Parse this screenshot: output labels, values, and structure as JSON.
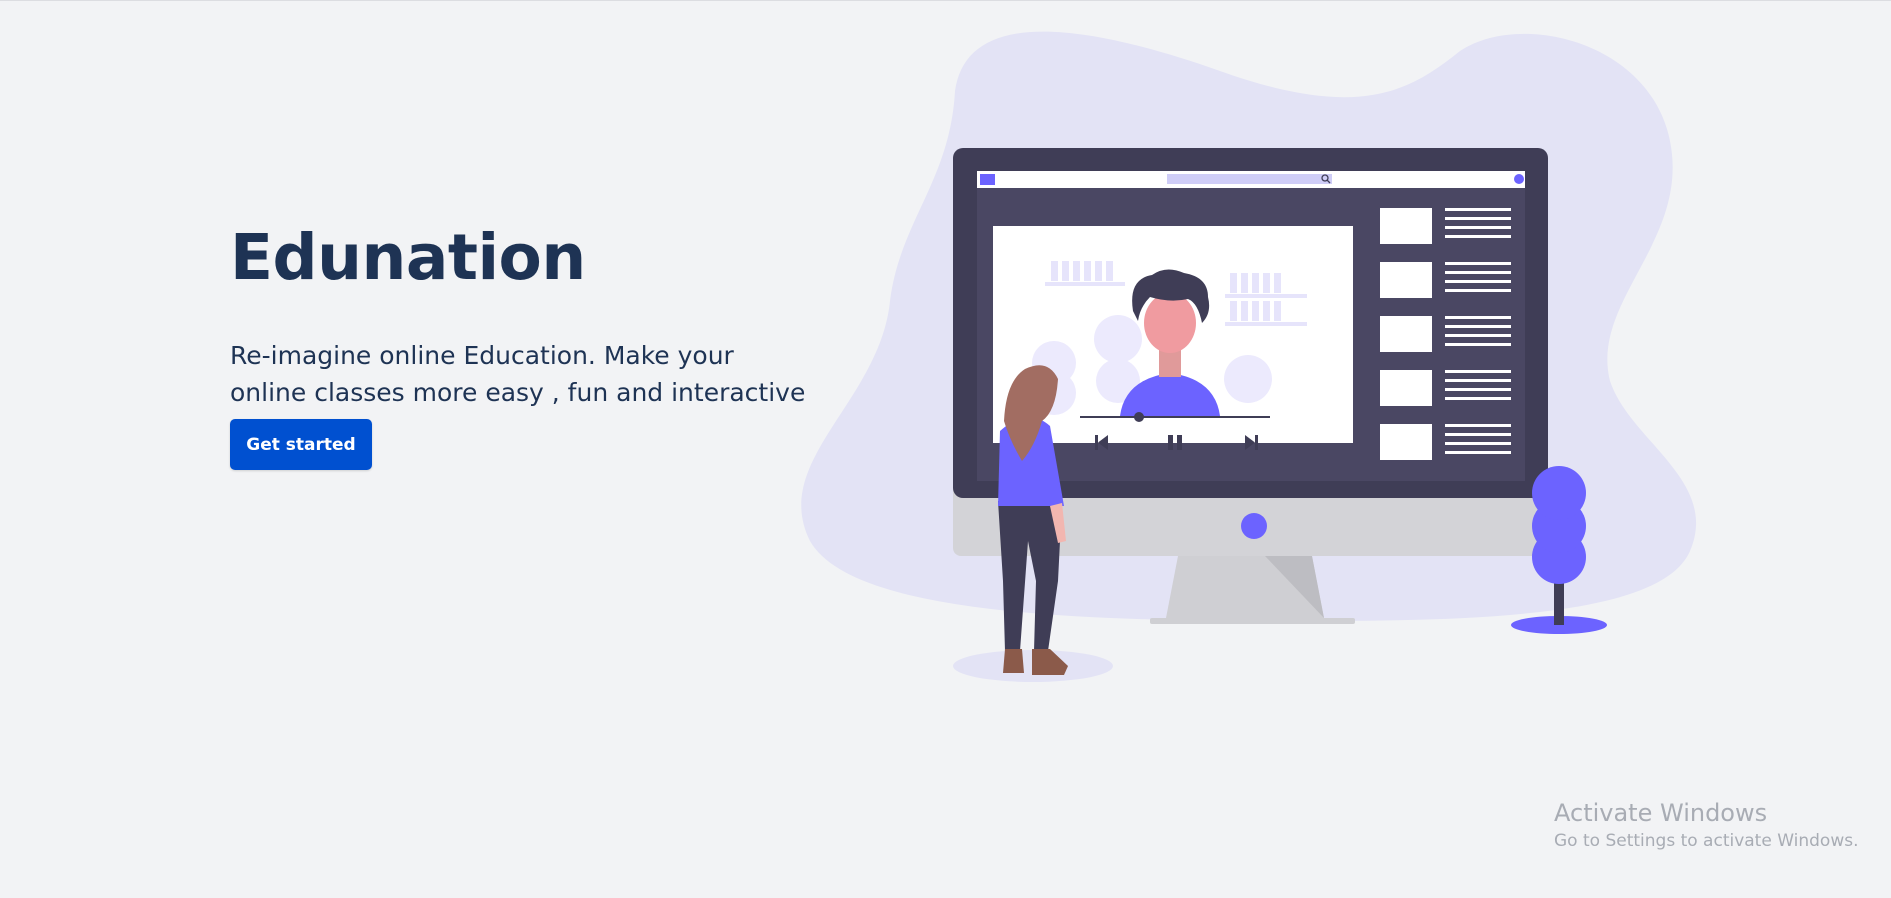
{
  "hero": {
    "title": "Edunation",
    "subtitle": "Re-imagine online Education. Make your online classes more easy , fun and interactive",
    "cta_label": "Get started"
  },
  "illustration": {
    "icons": [
      "search-icon",
      "previous-icon",
      "pause-icon",
      "next-icon"
    ],
    "colors": {
      "accent": "#6c63ff",
      "blob": "#e3e3f5",
      "monitor": "#3f3d56",
      "screen": "#4a4763"
    }
  },
  "watermark": {
    "title": "Activate Windows",
    "subtitle": "Go to Settings to activate Windows."
  }
}
